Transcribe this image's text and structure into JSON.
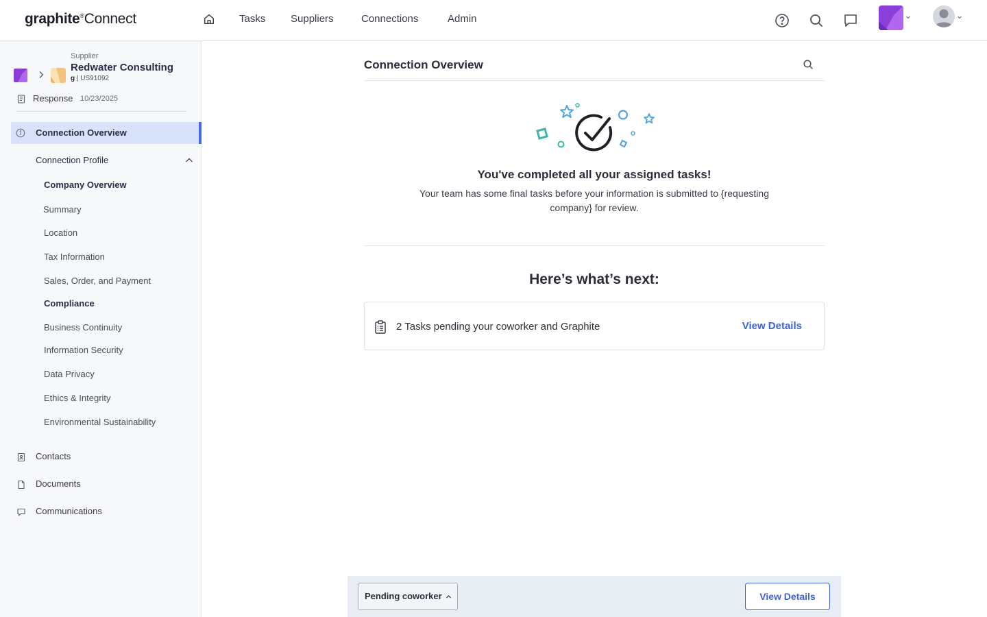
{
  "app": {
    "logo_brand": "graphite",
    "logo_reg": "®",
    "logo_product": "Connect"
  },
  "topnav": {
    "items": [
      {
        "label": "Tasks"
      },
      {
        "label": "Suppliers"
      },
      {
        "label": "Connections"
      },
      {
        "label": "Admin"
      }
    ],
    "icons": [
      "home-icon",
      "help-icon",
      "search-icon",
      "chat-icon",
      "chevron-down-icon",
      "user-avatar-icon"
    ]
  },
  "supplier": {
    "type": "Supplier",
    "name": "Redwater Consulting",
    "prefix": "g",
    "separator": "|",
    "id": "US91092"
  },
  "response": {
    "label": "Response",
    "date": "10/23/2025"
  },
  "sidebar": {
    "active": "Connection Overview",
    "profile": "Connection Profile",
    "items": [
      {
        "label": "Company Overview",
        "bold": true
      },
      {
        "label": "Summary"
      },
      {
        "label": "Location"
      },
      {
        "label": "Tax Information"
      },
      {
        "label": "Sales, Order, and Payment"
      },
      {
        "label": "Compliance",
        "bold": true
      },
      {
        "label": "Business Continuity"
      },
      {
        "label": "Information Security"
      },
      {
        "label": "Data Privacy"
      },
      {
        "label": "Ethics & Integrity"
      },
      {
        "label": "Environmental Sustainability"
      }
    ],
    "bottom": [
      {
        "label": "Contacts",
        "icon": "contacts-icon"
      },
      {
        "label": "Documents",
        "icon": "document-icon"
      },
      {
        "label": "Communications",
        "icon": "message-icon"
      }
    ]
  },
  "main": {
    "title": "Connection Overview",
    "done_title": "You've completed all your assigned tasks!",
    "done_sub": "Your team has some final tasks before your information is submitted to {requesting company} for review.",
    "next_title": "Here’s what’s next:",
    "task": {
      "text": "2 Tasks pending your coworker and Graphite",
      "link": "View Details"
    }
  },
  "statusbar": {
    "status": "Pending coworker",
    "button": "View Details"
  },
  "colors": {
    "accent": "#3f63d6",
    "active_bg": "#d9e2fb",
    "active_border": "#4368e8",
    "sidebar_bg": "#f7f8fa",
    "statusbar_bg": "#e8ecf3",
    "brand_purple": "#8b3fd9",
    "supplier_orange": "#f5c27a",
    "confetti_blue": "#4fa3e0",
    "confetti_teal": "#3bb7a8"
  }
}
